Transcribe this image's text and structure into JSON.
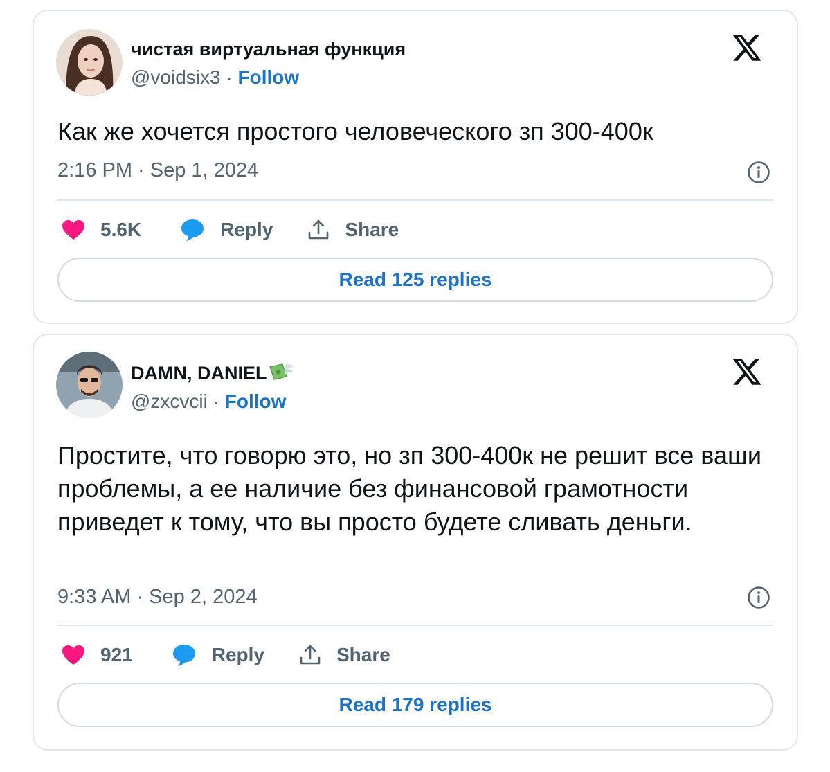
{
  "tweets": [
    {
      "display_name": "чистая виртуальная функция",
      "handle": "@voidsix3",
      "separator": "·",
      "follow_label": "Follow",
      "text": "Как же хочется простого человеческого зп 300-400к",
      "timestamp": "2:16 PM · Sep 1, 2024",
      "likes": "5.6K",
      "reply_label": "Reply",
      "share_label": "Share",
      "read_replies_label": "Read 125 replies"
    },
    {
      "display_name": "DAMN, DANIEL",
      "name_emoji": "money-with-wings-icon",
      "handle": "@zxcvcii",
      "separator": "·",
      "follow_label": "Follow",
      "text": "Простите, что говорю это, но зп 300-400к не решит все ваши проблемы, а ее наличие без финансовой грамотности приведет к тому, что вы просто будете сливать деньги.",
      "timestamp": "9:33 AM · Sep 2, 2024",
      "likes": "921",
      "reply_label": "Reply",
      "share_label": "Share",
      "read_replies_label": "Read 179 replies"
    }
  ],
  "colors": {
    "accent": "#1d74c7",
    "heart": "#f91880",
    "reply_bubble": "#1d9bf0",
    "muted": "#536471",
    "border": "#e3e6e8"
  }
}
